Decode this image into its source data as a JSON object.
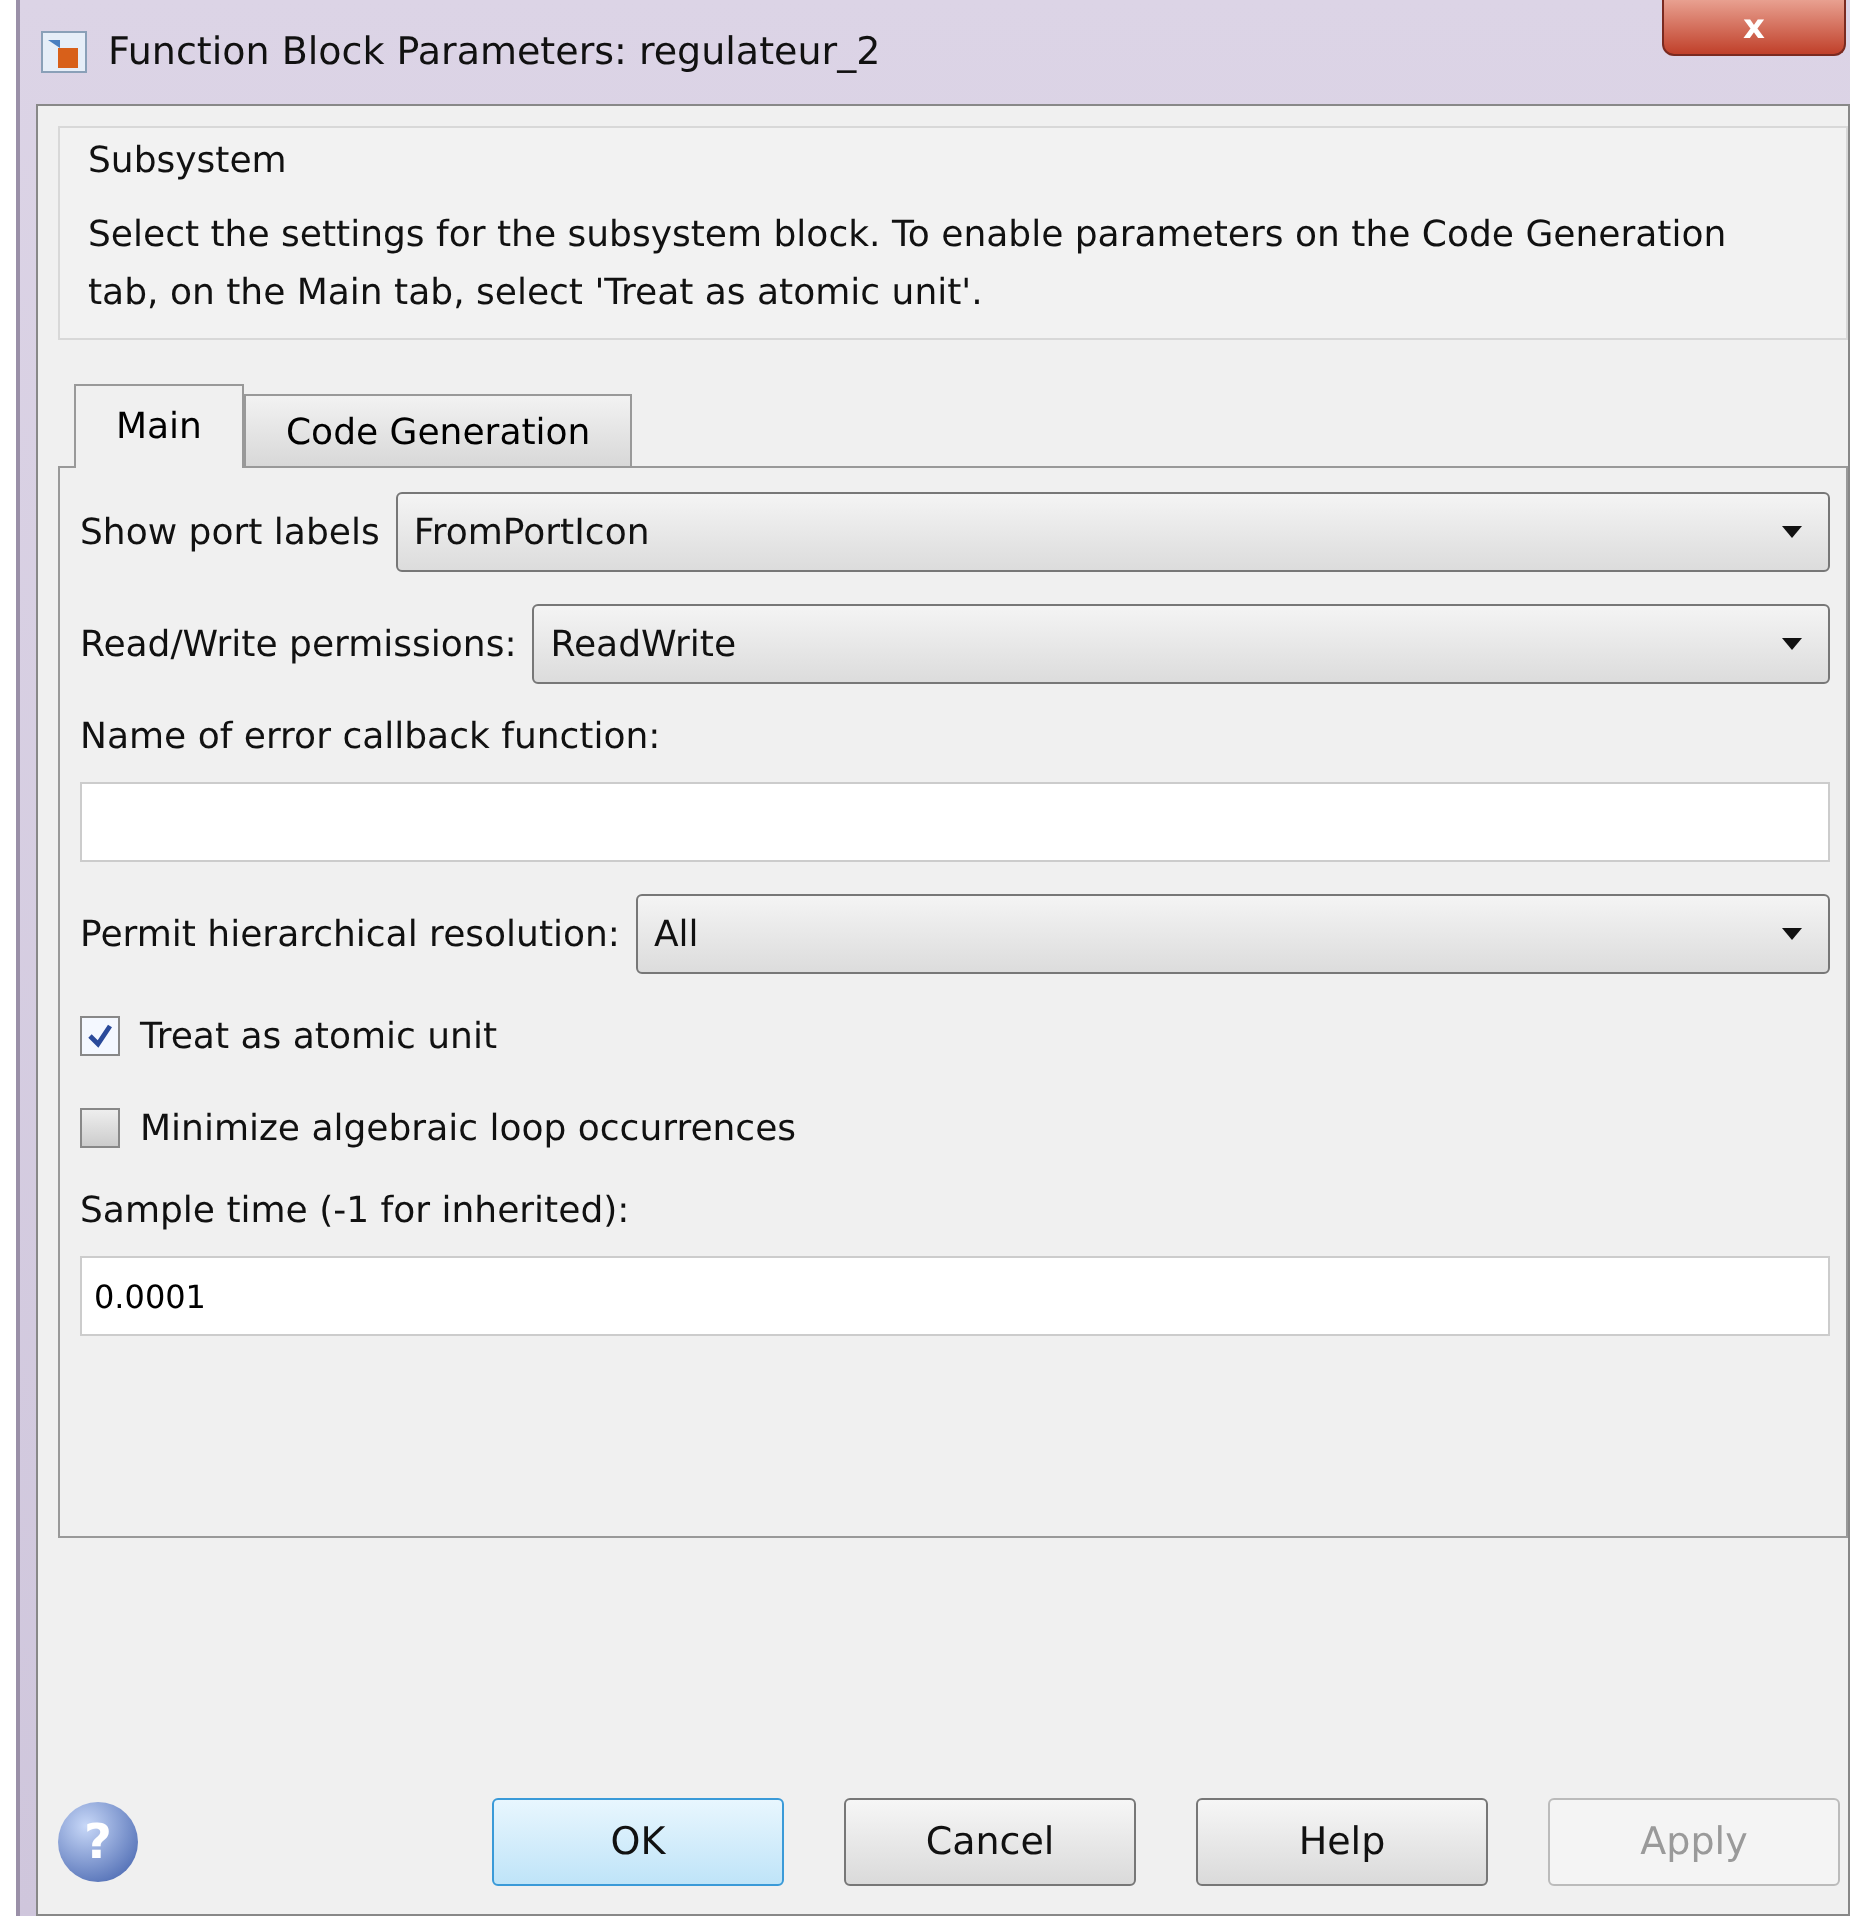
{
  "window": {
    "title": "Function Block Parameters: regulateur_2",
    "close": "x"
  },
  "group": {
    "title": "Subsystem",
    "description": "Select the settings for the subsystem block. To enable parameters on the Code Generation tab, on the Main tab, select 'Treat as atomic unit'."
  },
  "tabs": [
    {
      "label": "Main",
      "selected": true
    },
    {
      "label": "Code Generation",
      "selected": false
    }
  ],
  "fields": [
    {
      "kind": "dropdown",
      "label": "Show port labels",
      "value": "FromPortIcon"
    },
    {
      "kind": "dropdown",
      "label": "Read/Write permissions:",
      "value": "ReadWrite"
    },
    {
      "kind": "text",
      "label": "Name of error callback function:"
    },
    {
      "kind": "dropdown",
      "label": "Permit hierarchical resolution:",
      "value": "All"
    },
    {
      "kind": "checkbox",
      "label": "Treat as atomic unit",
      "checked": true
    },
    {
      "kind": "checkbox",
      "label": "Minimize algebraic loop occurrences",
      "checked": false
    },
    {
      "kind": "text",
      "label": "Sample time (-1 for inherited):",
      "value": "0.0001"
    }
  ],
  "help_icon": "?",
  "buttons": [
    {
      "label": "OK",
      "default": true,
      "disabled": false
    },
    {
      "label": "Cancel",
      "default": false,
      "disabled": false
    },
    {
      "label": "Help",
      "default": false,
      "disabled": false
    },
    {
      "label": "Apply",
      "default": false,
      "disabled": true
    }
  ]
}
